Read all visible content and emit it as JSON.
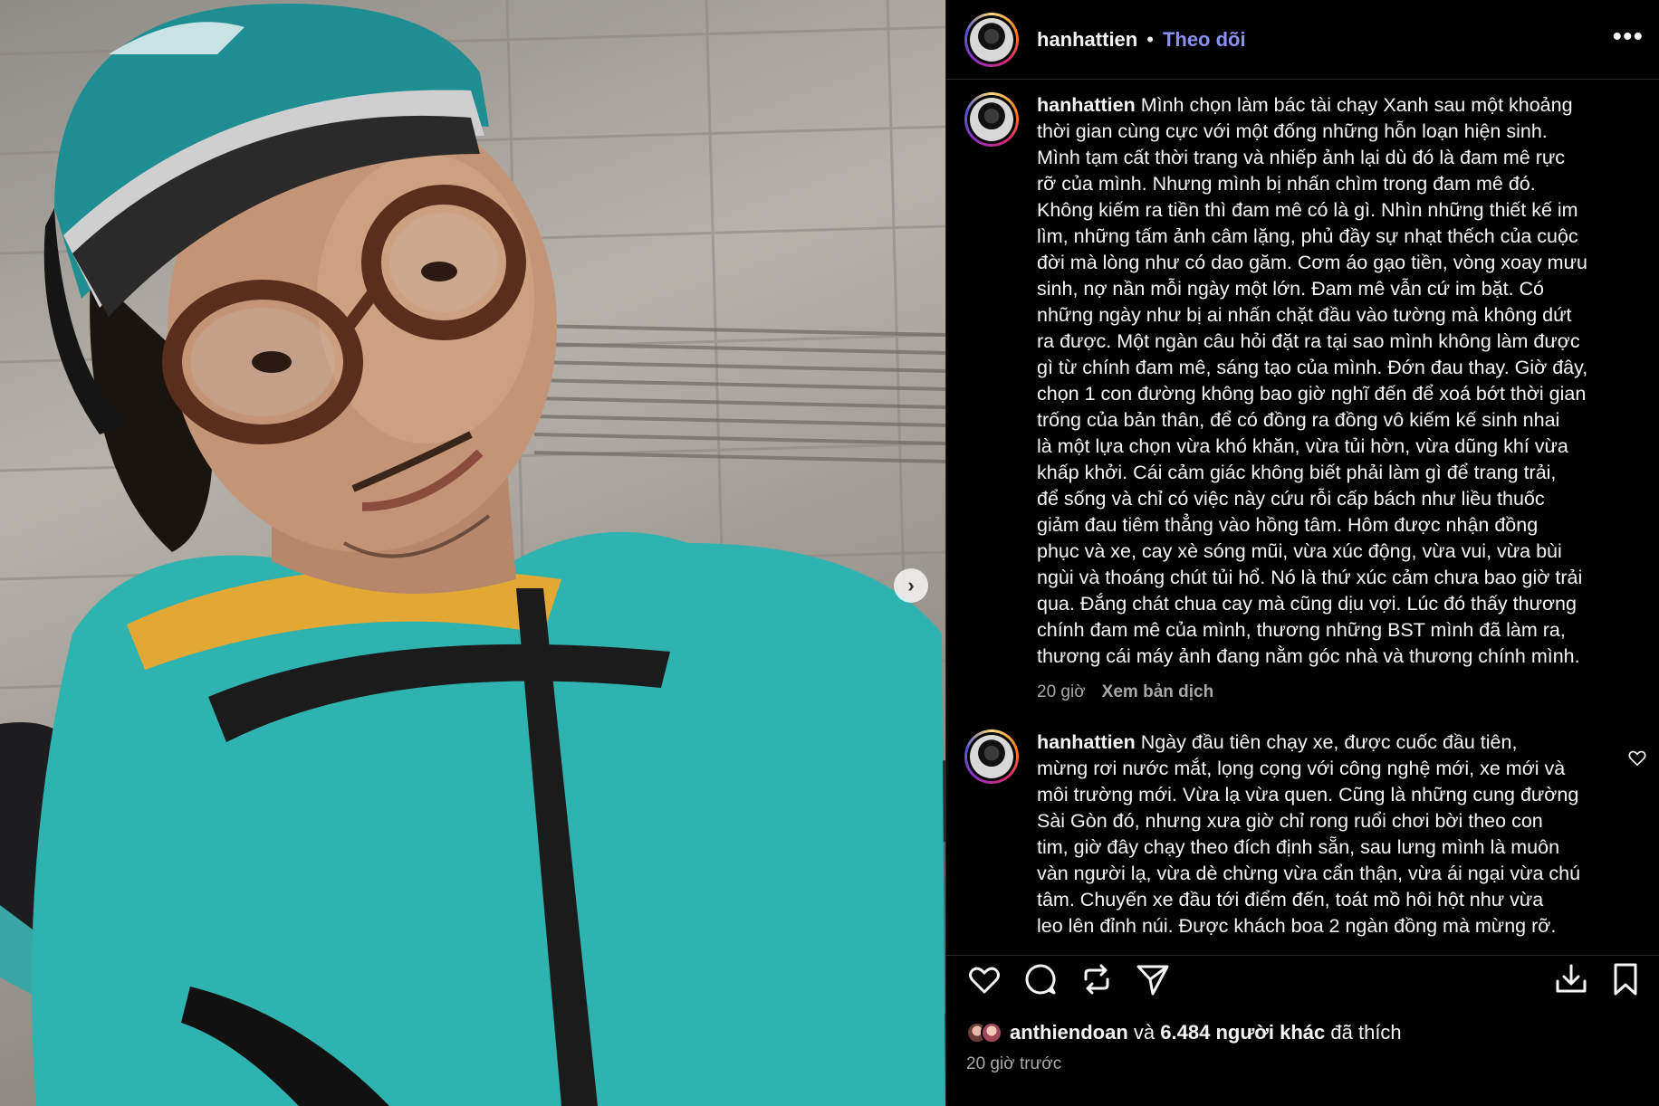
{
  "header": {
    "username": "hanhattien",
    "separator": "•",
    "follow_label": "Theo dõi",
    "more_label": "•••"
  },
  "caption": {
    "username": "hanhattien",
    "text": "Mình chọn làm bác tài chạy Xanh sau một khoảng\nthời gian cùng cực với một đống những hỗn loạn hiện sinh.\nMình tạm cất thời trang và nhiếp ảnh lại dù đó là đam mê rực\nrỡ của mình. Nhưng mình bị nhấn chìm trong đam mê đó.\nKhông kiếm ra tiền thì đam mê có là gì. Nhìn những thiết kế im\nlìm, những tấm ảnh câm lặng, phủ đầy sự nhạt thếch của cuộc\nđời mà lòng như có dao găm. Cơm áo gạo tiền, vòng xoay mưu\nsinh, nợ nần mỗi ngày một lớn. Đam mê vẫn cứ im bặt. Có\nnhững ngày như bị ai nhấn chặt đầu vào tường mà không dứt\nra được. Một ngàn câu hỏi đặt ra tại sao mình không làm được\ngì từ chính đam mê, sáng tạo của mình. Đớn đau thay. Giờ đây,\nchọn 1 con đường không bao giờ nghĩ đến để xoá bớt thời gian\ntrống của bản thân, để có đồng ra đồng vô kiếm kế sinh nhai\nlà một lựa chọn vừa khó khăn, vừa tủi hờn, vừa dũng khí vừa\nkhấp khởi. Cái cảm giác không biết phải làm gì để trang trải,\nđể sống và chỉ có việc này cứu rỗi cấp bách như liều thuốc\ngiảm đau tiêm thẳng vào hồng tâm. Hôm được nhận đồng\nphục và xe, cay xè sóng mũi, vừa xúc động, vừa vui, vừa bùi\nngùi và thoáng chút tủi hổ. Nó là thứ xúc cảm chưa bao giờ trải\nqua. Đắng chát chua cay mà cũng dịu vợi. Lúc đó thấy thương\nchính đam mê của mình, thương những BST mình đã làm ra,\nthương cái máy ảnh đang nằm góc nhà và thương chính mình.",
    "time": "20 giờ",
    "translate_label": "Xem bản dịch"
  },
  "comment": {
    "username": "hanhattien",
    "text": "Ngày đầu tiên chạy xe, được cuốc đầu tiên,\nmừng rơi nước mắt, lọng cọng với công nghệ mới, xe mới và\nmôi trường mới. Vừa lạ vừa quen. Cũng là những cung đường\nSài Gòn đó, nhưng xưa giờ chỉ rong ruổi chơi bời theo con\ntim, giờ đây chạy theo đích định sẵn, sau lưng mình là muôn\nvàn người lạ, vừa dè chừng vừa cẩn thận, vừa ái ngại vừa chú\ntâm. Chuyến xe đầu tới điểm đến, toát mồ hôi hột như vừa\nleo lên đỉnh núi. Được khách boa 2 ngàn đồng mà mừng rỡ."
  },
  "likes": {
    "first_user": "anthiendoan",
    "connector": "và",
    "others": "6.484 người khác",
    "suffix": "đã thích"
  },
  "post_time": "20 giờ trước",
  "carousel_next_glyph": "›",
  "colors": {
    "background": "#000000",
    "follow": "#8c8ff5",
    "muted": "#a8a8a8",
    "jacket": "#2fb3b0",
    "helmet": "#1f8e93"
  }
}
